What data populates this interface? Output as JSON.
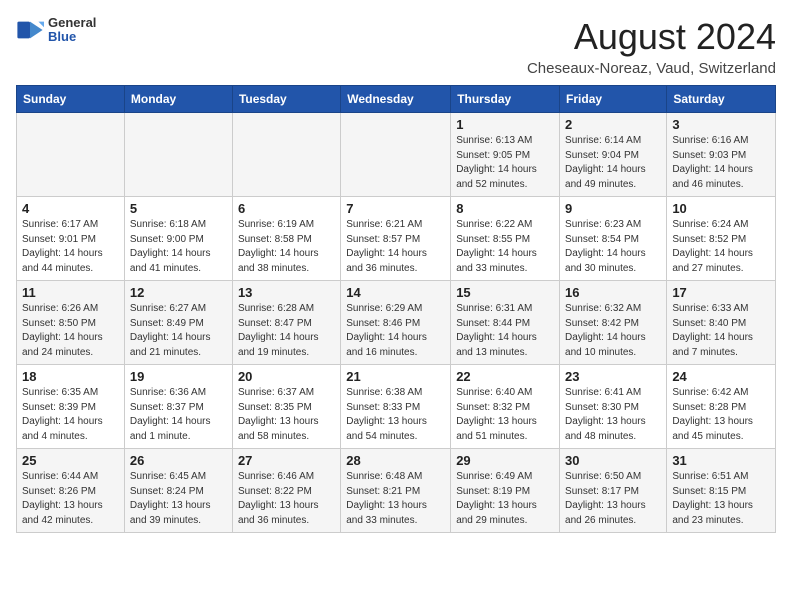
{
  "header": {
    "logo_general": "General",
    "logo_blue": "Blue",
    "month_title": "August 2024",
    "location": "Cheseaux-Noreaz, Vaud, Switzerland"
  },
  "days_of_week": [
    "Sunday",
    "Monday",
    "Tuesday",
    "Wednesday",
    "Thursday",
    "Friday",
    "Saturday"
  ],
  "weeks": [
    [
      {
        "day": "",
        "info": ""
      },
      {
        "day": "",
        "info": ""
      },
      {
        "day": "",
        "info": ""
      },
      {
        "day": "",
        "info": ""
      },
      {
        "day": "1",
        "info": "Sunrise: 6:13 AM\nSunset: 9:05 PM\nDaylight: 14 hours\nand 52 minutes."
      },
      {
        "day": "2",
        "info": "Sunrise: 6:14 AM\nSunset: 9:04 PM\nDaylight: 14 hours\nand 49 minutes."
      },
      {
        "day": "3",
        "info": "Sunrise: 6:16 AM\nSunset: 9:03 PM\nDaylight: 14 hours\nand 46 minutes."
      }
    ],
    [
      {
        "day": "4",
        "info": "Sunrise: 6:17 AM\nSunset: 9:01 PM\nDaylight: 14 hours\nand 44 minutes."
      },
      {
        "day": "5",
        "info": "Sunrise: 6:18 AM\nSunset: 9:00 PM\nDaylight: 14 hours\nand 41 minutes."
      },
      {
        "day": "6",
        "info": "Sunrise: 6:19 AM\nSunset: 8:58 PM\nDaylight: 14 hours\nand 38 minutes."
      },
      {
        "day": "7",
        "info": "Sunrise: 6:21 AM\nSunset: 8:57 PM\nDaylight: 14 hours\nand 36 minutes."
      },
      {
        "day": "8",
        "info": "Sunrise: 6:22 AM\nSunset: 8:55 PM\nDaylight: 14 hours\nand 33 minutes."
      },
      {
        "day": "9",
        "info": "Sunrise: 6:23 AM\nSunset: 8:54 PM\nDaylight: 14 hours\nand 30 minutes."
      },
      {
        "day": "10",
        "info": "Sunrise: 6:24 AM\nSunset: 8:52 PM\nDaylight: 14 hours\nand 27 minutes."
      }
    ],
    [
      {
        "day": "11",
        "info": "Sunrise: 6:26 AM\nSunset: 8:50 PM\nDaylight: 14 hours\nand 24 minutes."
      },
      {
        "day": "12",
        "info": "Sunrise: 6:27 AM\nSunset: 8:49 PM\nDaylight: 14 hours\nand 21 minutes."
      },
      {
        "day": "13",
        "info": "Sunrise: 6:28 AM\nSunset: 8:47 PM\nDaylight: 14 hours\nand 19 minutes."
      },
      {
        "day": "14",
        "info": "Sunrise: 6:29 AM\nSunset: 8:46 PM\nDaylight: 14 hours\nand 16 minutes."
      },
      {
        "day": "15",
        "info": "Sunrise: 6:31 AM\nSunset: 8:44 PM\nDaylight: 14 hours\nand 13 minutes."
      },
      {
        "day": "16",
        "info": "Sunrise: 6:32 AM\nSunset: 8:42 PM\nDaylight: 14 hours\nand 10 minutes."
      },
      {
        "day": "17",
        "info": "Sunrise: 6:33 AM\nSunset: 8:40 PM\nDaylight: 14 hours\nand 7 minutes."
      }
    ],
    [
      {
        "day": "18",
        "info": "Sunrise: 6:35 AM\nSunset: 8:39 PM\nDaylight: 14 hours\nand 4 minutes."
      },
      {
        "day": "19",
        "info": "Sunrise: 6:36 AM\nSunset: 8:37 PM\nDaylight: 14 hours\nand 1 minute."
      },
      {
        "day": "20",
        "info": "Sunrise: 6:37 AM\nSunset: 8:35 PM\nDaylight: 13 hours\nand 58 minutes."
      },
      {
        "day": "21",
        "info": "Sunrise: 6:38 AM\nSunset: 8:33 PM\nDaylight: 13 hours\nand 54 minutes."
      },
      {
        "day": "22",
        "info": "Sunrise: 6:40 AM\nSunset: 8:32 PM\nDaylight: 13 hours\nand 51 minutes."
      },
      {
        "day": "23",
        "info": "Sunrise: 6:41 AM\nSunset: 8:30 PM\nDaylight: 13 hours\nand 48 minutes."
      },
      {
        "day": "24",
        "info": "Sunrise: 6:42 AM\nSunset: 8:28 PM\nDaylight: 13 hours\nand 45 minutes."
      }
    ],
    [
      {
        "day": "25",
        "info": "Sunrise: 6:44 AM\nSunset: 8:26 PM\nDaylight: 13 hours\nand 42 minutes."
      },
      {
        "day": "26",
        "info": "Sunrise: 6:45 AM\nSunset: 8:24 PM\nDaylight: 13 hours\nand 39 minutes."
      },
      {
        "day": "27",
        "info": "Sunrise: 6:46 AM\nSunset: 8:22 PM\nDaylight: 13 hours\nand 36 minutes."
      },
      {
        "day": "28",
        "info": "Sunrise: 6:48 AM\nSunset: 8:21 PM\nDaylight: 13 hours\nand 33 minutes."
      },
      {
        "day": "29",
        "info": "Sunrise: 6:49 AM\nSunset: 8:19 PM\nDaylight: 13 hours\nand 29 minutes."
      },
      {
        "day": "30",
        "info": "Sunrise: 6:50 AM\nSunset: 8:17 PM\nDaylight: 13 hours\nand 26 minutes."
      },
      {
        "day": "31",
        "info": "Sunrise: 6:51 AM\nSunset: 8:15 PM\nDaylight: 13 hours\nand 23 minutes."
      }
    ]
  ]
}
